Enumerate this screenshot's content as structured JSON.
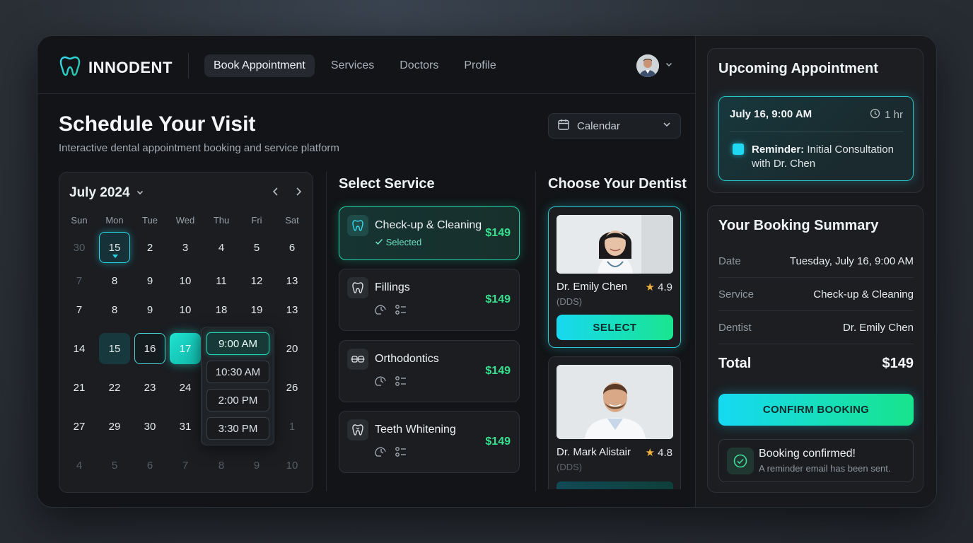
{
  "brand": {
    "name": "INNODENT"
  },
  "nav": {
    "links": [
      "Book Appointment",
      "Services",
      "Doctors",
      "Profile"
    ],
    "active_index": 0
  },
  "page": {
    "title": "Schedule Your Visit",
    "subtitle": "Interactive dental appointment booking and service platform",
    "view_select": "Calendar"
  },
  "calendar": {
    "month_label": "July 2024",
    "weekdays": [
      "Sun",
      "Mon",
      "Tue",
      "Wed",
      "Thu",
      "Fri",
      "Sat"
    ],
    "rows": [
      [
        "30",
        "15",
        "2",
        "3",
        "4",
        "5",
        "6"
      ],
      [
        "7",
        "8",
        "9",
        "10",
        "11",
        "12",
        "13"
      ],
      [
        "7",
        "8",
        "9",
        "10",
        "18",
        "19",
        "13"
      ],
      [
        "14",
        "15",
        "16",
        "17",
        "",
        "",
        "20"
      ],
      [
        "21",
        "22",
        "23",
        "24",
        "",
        "",
        "26"
      ],
      [
        "27",
        "29",
        "30",
        "31",
        "",
        "",
        "1"
      ],
      [
        "4",
        "5",
        "6",
        "7",
        "8",
        "9",
        "10"
      ]
    ],
    "time_slots": [
      "9:00 AM",
      "10:30 AM",
      "2:00 PM",
      "3:30 PM"
    ],
    "selected_time_index": 0
  },
  "services": {
    "title": "Select Service",
    "items": [
      {
        "name": "Check-up & Cleaning",
        "price": "$149",
        "status": "Selected",
        "icon": "tooth-icon"
      },
      {
        "name": "Fillings",
        "price": "$149",
        "icon": "tooth-icon"
      },
      {
        "name": "Orthodontics",
        "price": "$149",
        "icon": "braces-icon"
      },
      {
        "name": "Teeth Whitening",
        "price": "$149",
        "icon": "tooth-icon"
      }
    ]
  },
  "dentists": {
    "title": "Choose Your Dentist",
    "items": [
      {
        "name": "Dr. Emily Chen",
        "rating": "4.9",
        "degree": "(DDS)",
        "button": "SELECT"
      },
      {
        "name": "Dr. Mark Alistair",
        "rating": "4.8",
        "degree": "(DDS)"
      }
    ]
  },
  "upcoming": {
    "title": "Upcoming Appointment",
    "date": "July 16, 9:00 AM",
    "duration": "1 hr",
    "reminder_label": "Reminder:",
    "reminder_text": " Initial Consultation with Dr. Chen"
  },
  "summary": {
    "title": "Your Booking Summary",
    "rows": [
      {
        "label": "Date",
        "value": "Tuesday, July 16, 9:00 AM"
      },
      {
        "label": "Service",
        "value": "Check-up & Cleaning"
      },
      {
        "label": "Dentist",
        "value": "Dr. Emily Chen"
      }
    ],
    "total_label": "Total",
    "total_value": "$149",
    "confirm_button": "CONFIRM BOOKING"
  },
  "toast": {
    "title": "Booking confirmed!",
    "message": "A reminder email has been sent."
  },
  "colors": {
    "accent_cyan": "#17d8f0",
    "accent_green": "#19e58f",
    "price_green": "#37e08e",
    "background": "#121417"
  }
}
